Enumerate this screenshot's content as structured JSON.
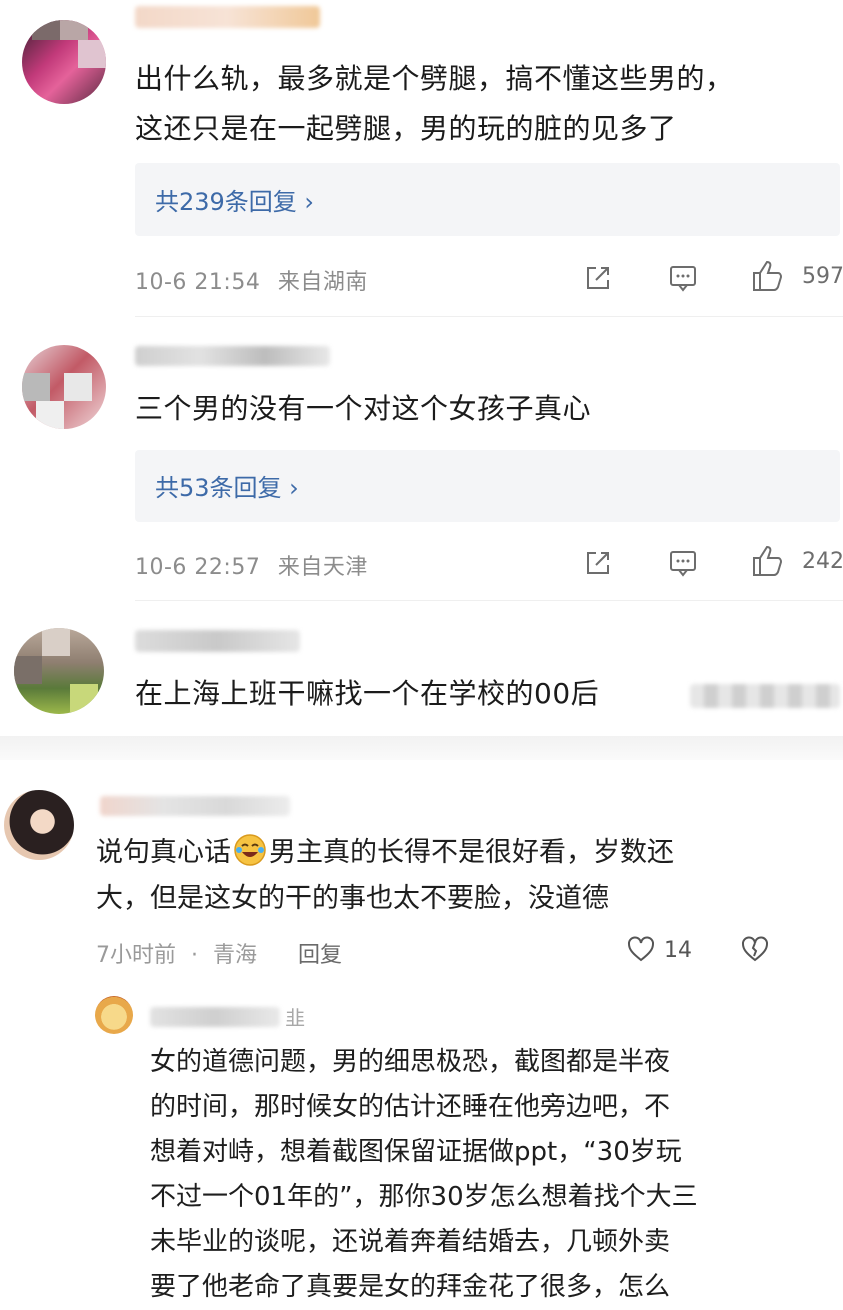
{
  "comments": [
    {
      "text_lines": [
        "出什么轨，最多就是个劈腿，搞不懂这些男的，",
        "这还只是在一起劈腿，男的玩的脏的见多了"
      ],
      "reply_link": "共239条回复 ›",
      "time": "10-6 21:54",
      "location": "来自湖南",
      "likes": "597"
    },
    {
      "text_lines": [
        "三个男的没有一个对这个女孩子真心"
      ],
      "reply_link": "共53条回复 ›",
      "time": "10-6 22:57",
      "location": "来自天津",
      "likes": "242"
    },
    {
      "text_lines": [
        "在上海上班干嘛找一个在学校的00后"
      ]
    }
  ],
  "second_section": {
    "comment": {
      "line1_before": "说句真心话",
      "line1_after": "男主真的长得不是很好看，岁数还",
      "line2": "大，但是这女的干的事也太不要脸，没道德",
      "time": "7小时前",
      "location": "青海",
      "reply_label": "回复",
      "likes": "14"
    },
    "reply": {
      "name_suffix": "韭",
      "lines": [
        "女的道德问题，男的细思极恐，截图都是半夜",
        "的时间，那时候女的估计还睡在他旁边吧，不",
        "想着对峙，想着截图保留证据做ppt，“30岁玩",
        "不过一个01年的”，那你30岁怎么想着找个大三",
        "未毕业的谈呢，还说着奔着结婚去，几顿外卖",
        "要了他老命了真要是女的拜金花了很多，怎么"
      ]
    }
  },
  "colors": {
    "link": "#3d6aa8",
    "meta": "#8c8c8c",
    "reply_bg": "#f4f5f7"
  }
}
